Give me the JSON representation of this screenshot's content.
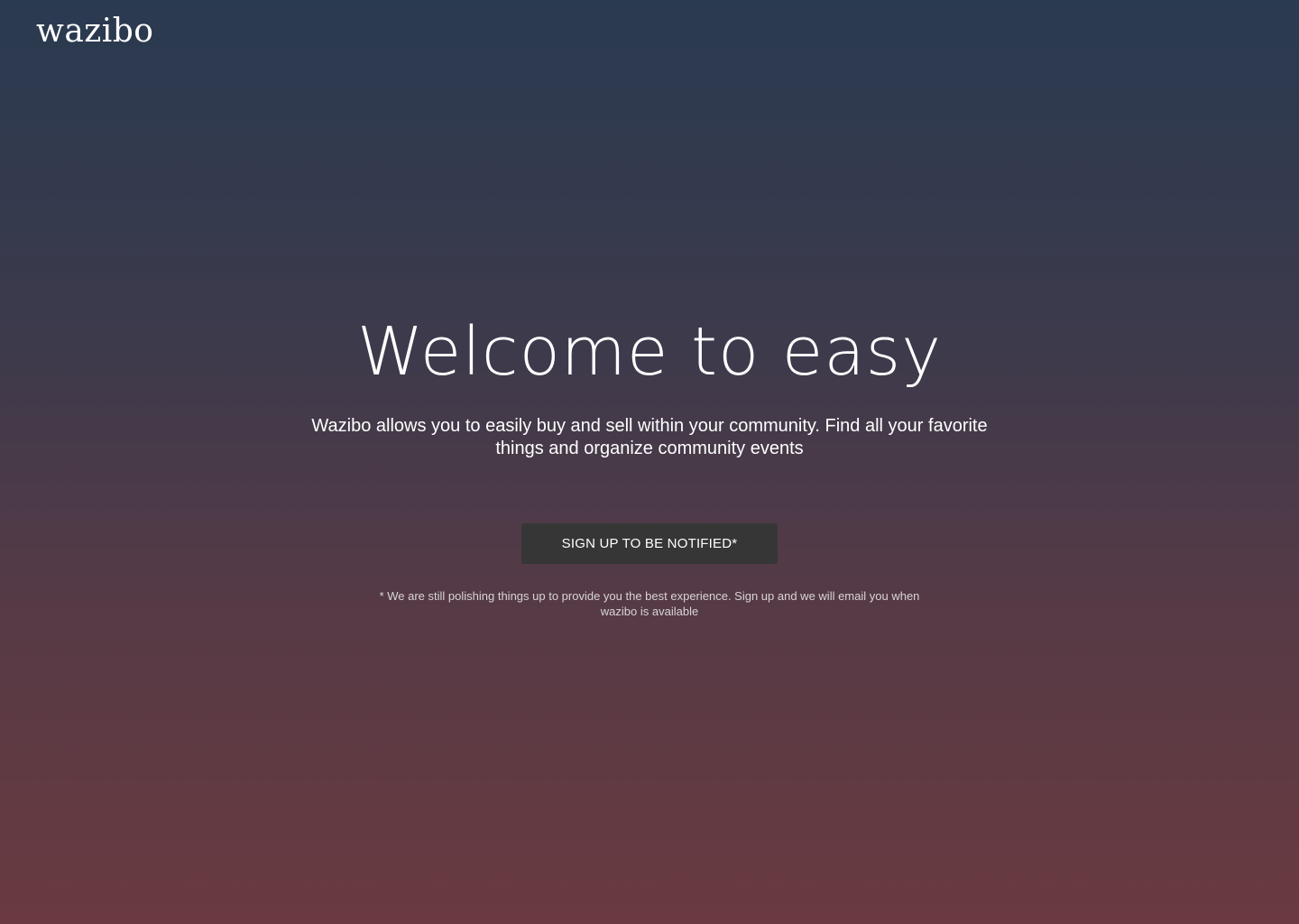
{
  "header": {
    "logo_text": "wazibo"
  },
  "hero": {
    "headline": "Welcome to easy",
    "subtitle": "Wazibo allows you to easily buy and sell within your community. Find all your favorite things and organize community events",
    "cta_label": "SIGN UP TO BE NOTIFIED*",
    "footnote": "* We are still polishing things up to provide you the best experience. Sign up and we will email you when wazibo is available"
  },
  "colors": {
    "gradient_top": "#2a3a51",
    "gradient_bottom": "#6a3a40",
    "button_bg": "#363636",
    "text": "#ffffff"
  }
}
